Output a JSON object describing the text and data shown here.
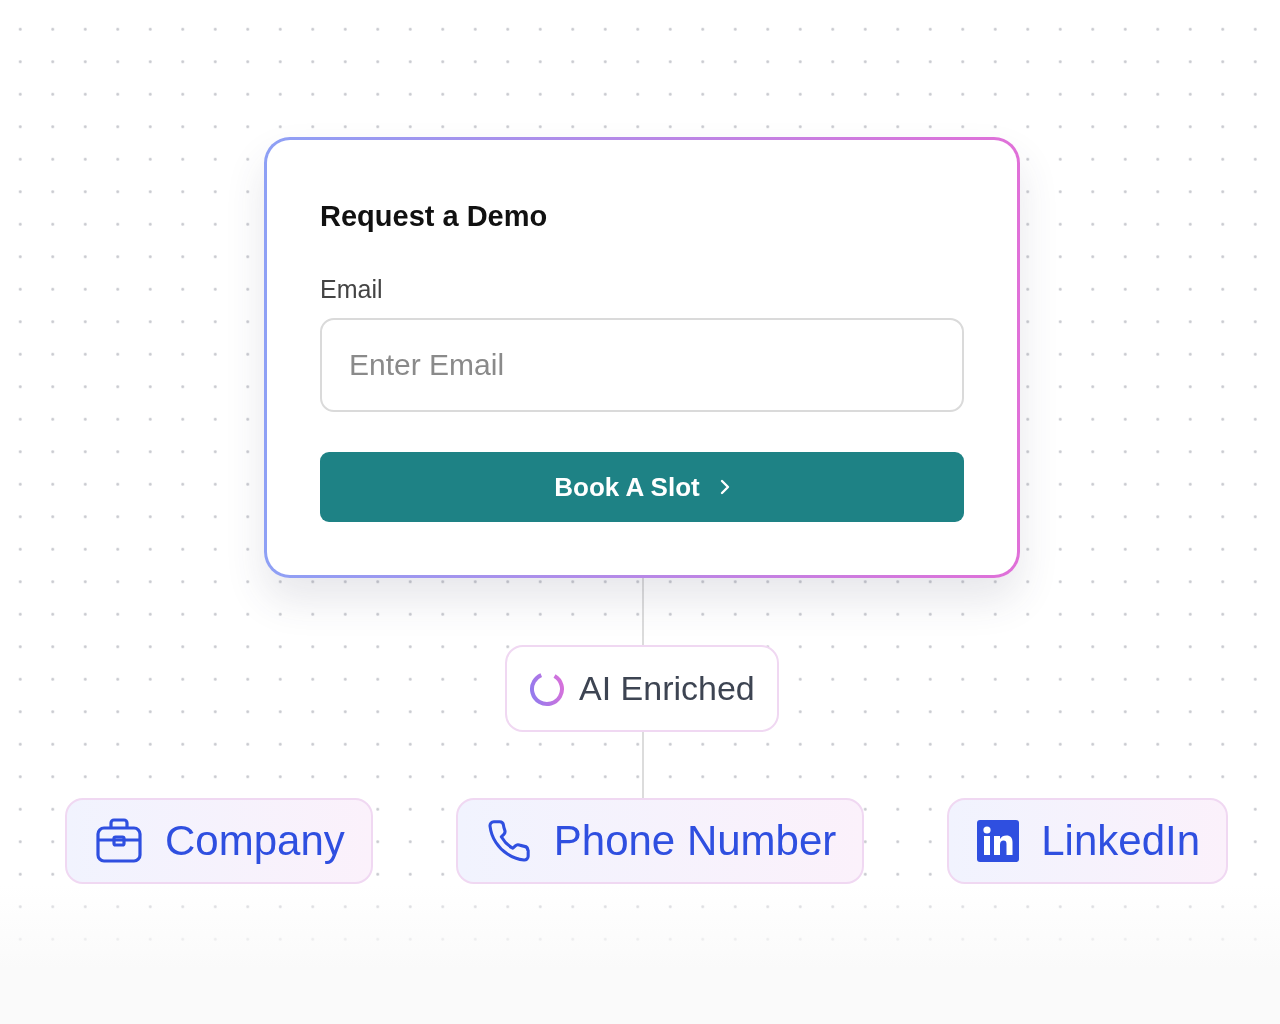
{
  "form": {
    "title": "Request a Demo",
    "email_label": "Email",
    "email_placeholder": "Enter Email",
    "button": "Book A Slot"
  },
  "enrichment": {
    "label": "AI Enriched"
  },
  "fields": [
    {
      "kind": "company",
      "label": "Company"
    },
    {
      "kind": "phone",
      "label": "Phone Number"
    },
    {
      "kind": "linkedin",
      "label": "LinkedIn"
    }
  ]
}
